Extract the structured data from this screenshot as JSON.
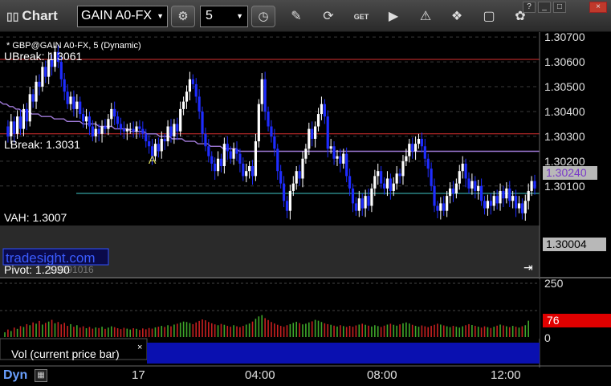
{
  "app": {
    "title": "Chart"
  },
  "toolbar": {
    "symbol": "GAIN A0-FX",
    "interval": "5",
    "icons": [
      "gear-icon",
      "clock-icon",
      "pencil-icon",
      "refresh-icon",
      "get-icon",
      "play-icon",
      "alert-icon",
      "tag-icon",
      "chat-icon",
      "twitter-icon"
    ],
    "window_buttons": [
      "?",
      "_",
      "□",
      "×"
    ]
  },
  "price_panel": {
    "header": "* GBP@GAIN A0-FX, 5 (Dynamic)",
    "watermark": "tradesight.com",
    "levels": [
      {
        "label": "UBreak: 1.3061",
        "price": 1.3061,
        "color": "#d83030"
      },
      {
        "label": "LBreak: 1.3031",
        "price": 1.3031,
        "color": "#d83030"
      },
      {
        "label": "VAH: 1.3007",
        "price": 1.3007,
        "color": "#40c8c8"
      },
      {
        "label": "Pivot: 1.2990",
        "price": 1.299,
        "color": "#ffffff"
      }
    ],
    "marker": "A",
    "ma_price": "1.30240",
    "last_price": "1.30004",
    "pivot_overlay_text": "1.2991016"
  },
  "volume_panel": {
    "label": "Vol (current price bar)",
    "close_glyph": "×",
    "current_value": "76",
    "scale_labels": [
      "250",
      "0"
    ]
  },
  "time_axis": {
    "status_label": "Dyn",
    "labels": [
      "17",
      "04:00",
      "08:00",
      "12:00"
    ]
  },
  "chart_data": {
    "type": "candlestick",
    "price_axis": {
      "ylim": [
        1.2975,
        1.3072
      ],
      "ticks": [
        "1.30700",
        "1.30600",
        "1.30500",
        "1.30400",
        "1.30300",
        "1.30200",
        "1.30100"
      ]
    },
    "volume_axis": {
      "ylim": [
        0,
        250
      ]
    },
    "colors": {
      "up": "#ffffff",
      "down": "#1e2cff",
      "ma": "#a07ad8",
      "vol_up": "#3fa82a",
      "vol_down": "#c82020"
    },
    "closes": [
      1.3034,
      1.303,
      1.3036,
      1.3031,
      1.3038,
      1.3033,
      1.3041,
      1.3036,
      1.3047,
      1.3044,
      1.3052,
      1.305,
      1.3058,
      1.3054,
      1.3061,
      1.3058,
      1.3064,
      1.306,
      1.3053,
      1.3048,
      1.3043,
      1.3046,
      1.3041,
      1.3044,
      1.3039,
      1.3036,
      1.3038,
      1.3034,
      1.303,
      1.3033,
      1.3031,
      1.3034,
      1.3033,
      1.3037,
      1.3041,
      1.3038,
      1.3035,
      1.3033,
      1.3032,
      1.3033,
      1.3033,
      1.3032,
      1.3034,
      1.3033,
      1.3031,
      1.3028,
      1.3026,
      1.3022,
      1.3027,
      1.3024,
      1.3029,
      1.3028,
      1.3034,
      1.303,
      1.3035,
      1.3032,
      1.3041,
      1.3044,
      1.3048,
      1.3053,
      1.3051,
      1.3046,
      1.304,
      1.3031,
      1.3026,
      1.3022,
      1.3019,
      1.3016,
      1.3021,
      1.3018,
      1.3027,
      1.3024,
      1.3021,
      1.3025,
      1.3023,
      1.3019,
      1.3014,
      1.3016,
      1.3018,
      1.3014,
      1.3028,
      1.3043,
      1.3053,
      1.304,
      1.3034,
      1.303,
      1.3025,
      1.3016,
      1.3011,
      1.3004,
      1.3,
      1.3008,
      1.3011,
      1.3016,
      1.3013,
      1.3021,
      1.3025,
      1.3033,
      1.3029,
      1.3034,
      1.3039,
      1.3043,
      1.3038,
      1.3025,
      1.3026,
      1.3021,
      1.3022,
      1.3019,
      1.3023,
      1.3014,
      1.3009,
      1.3003,
      1.3,
      1.3005,
      1.3001,
      1.3006,
      1.3002,
      1.3009,
      1.3014,
      1.3016,
      1.3011,
      1.3009,
      1.3013,
      1.3008,
      1.3011,
      1.3015,
      1.3014,
      1.302,
      1.3022,
      1.3027,
      1.3024,
      1.3027,
      1.3029,
      1.3026,
      1.3021,
      1.3017,
      1.301,
      1.3002,
      1.3,
      1.3003,
      1.3,
      1.3006,
      1.3009,
      1.3007,
      1.3011,
      1.3016,
      1.3019,
      1.3013,
      1.3009,
      1.3012,
      1.3008,
      1.301,
      1.3004,
      1.3001,
      1.3004,
      1.3002,
      1.3006,
      1.3003,
      1.3008,
      1.3005,
      1.3009,
      1.3004,
      1.3006,
      1.3001,
      1.3003,
      1.2999,
      1.3004,
      1.3008,
      1.3012,
      1.3009
    ],
    "volumes": [
      22,
      35,
      28,
      44,
      38,
      51,
      47,
      60,
      55,
      68,
      62,
      75,
      58,
      66,
      72,
      80,
      64,
      70,
      59,
      66,
      52,
      60,
      48,
      55,
      44,
      50,
      41,
      47,
      39,
      45,
      42,
      48,
      38,
      44,
      50,
      46,
      41,
      37,
      43,
      39,
      35,
      41,
      38,
      33,
      40,
      36,
      42,
      39,
      45,
      48,
      52,
      47,
      55,
      50,
      58,
      62,
      67,
      72,
      70,
      65,
      60,
      68,
      75,
      82,
      78,
      70,
      64,
      59,
      55,
      61,
      57,
      52,
      48,
      55,
      50,
      46,
      52,
      58,
      63,
      72,
      85,
      96,
      102,
      88,
      79,
      70,
      63,
      57,
      52,
      48,
      55,
      60,
      66,
      71,
      65,
      59,
      62,
      68,
      73,
      80,
      76,
      70,
      64,
      60,
      57,
      53,
      49,
      55,
      51,
      47,
      52,
      48,
      54,
      58,
      62,
      57,
      53,
      49,
      55,
      51,
      47,
      53,
      58,
      62,
      57,
      53,
      59,
      64,
      68,
      63,
      57,
      52,
      48,
      54,
      50,
      46,
      52,
      57,
      62,
      58,
      54,
      50,
      46,
      52,
      48,
      44,
      50,
      55,
      60,
      56,
      52,
      48,
      44,
      50,
      46,
      42,
      48,
      53,
      58,
      54,
      50,
      46,
      52,
      48,
      44,
      50,
      55,
      76
    ],
    "ma": [
      1.3044,
      1.3043,
      1.3043,
      1.3042,
      1.3042,
      1.3041,
      1.3041,
      1.304,
      1.304,
      1.304,
      1.3039,
      1.3039,
      1.3039,
      1.3038,
      1.3038,
      1.3038,
      1.3038,
      1.3037,
      1.3037,
      1.3037,
      1.3037,
      1.3036,
      1.3036,
      1.3036,
      1.3036,
      1.3036,
      1.3035,
      1.3035,
      1.3035,
      1.3035,
      1.3035,
      1.3034,
      1.3034,
      1.3034,
      1.3034,
      1.3034,
      1.3033,
      1.3033,
      1.3033,
      1.3033,
      1.3033,
      1.3032,
      1.3032,
      1.3032,
      1.3032,
      1.3032,
      1.3031,
      1.3031,
      1.3031,
      1.3031,
      1.303,
      1.303,
      1.303,
      1.303,
      1.3029,
      1.3029,
      1.3029,
      1.3029,
      1.3028,
      1.3028,
      1.3028,
      1.3028,
      1.3027,
      1.3027,
      1.3027,
      1.3027,
      1.3026,
      1.3026,
      1.3026,
      1.3026,
      1.3025,
      1.3025,
      1.3025,
      1.3025,
      1.3025,
      1.3024,
      1.3024,
      1.3024,
      1.3024,
      1.3024,
      1.3024,
      1.3024,
      1.3024,
      1.3024,
      1.3024,
      1.3024,
      1.3024,
      1.3024,
      1.3024,
      1.3024,
      1.3024,
      1.3024,
      1.3024,
      1.3024,
      1.3024,
      1.3024,
      1.3024,
      1.3024,
      1.3024,
      1.3024,
      1.3024,
      1.3024,
      1.3024,
      1.3024,
      1.3024,
      1.3024,
      1.3024,
      1.3024,
      1.3024,
      1.3024,
      1.3024,
      1.3024,
      1.3024,
      1.3024,
      1.3024,
      1.3024,
      1.3024,
      1.3024,
      1.3024,
      1.3024,
      1.3024,
      1.3024,
      1.3024,
      1.3024,
      1.3024,
      1.3024,
      1.3024,
      1.3024,
      1.3024,
      1.3024,
      1.3024,
      1.3024,
      1.3024,
      1.3024,
      1.3024,
      1.3024,
      1.3024,
      1.3024,
      1.3024,
      1.3024,
      1.3024,
      1.3024,
      1.3024,
      1.3024,
      1.3024,
      1.3024,
      1.3024,
      1.3024,
      1.3024,
      1.3024,
      1.3024,
      1.3024,
      1.3024,
      1.3024,
      1.3024,
      1.3024,
      1.3024,
      1.3024,
      1.3024,
      1.3024,
      1.3024,
      1.3024,
      1.3024,
      1.3024,
      1.3024,
      1.3024,
      1.3024,
      1.3024,
      1.3024,
      1.3024
    ]
  }
}
